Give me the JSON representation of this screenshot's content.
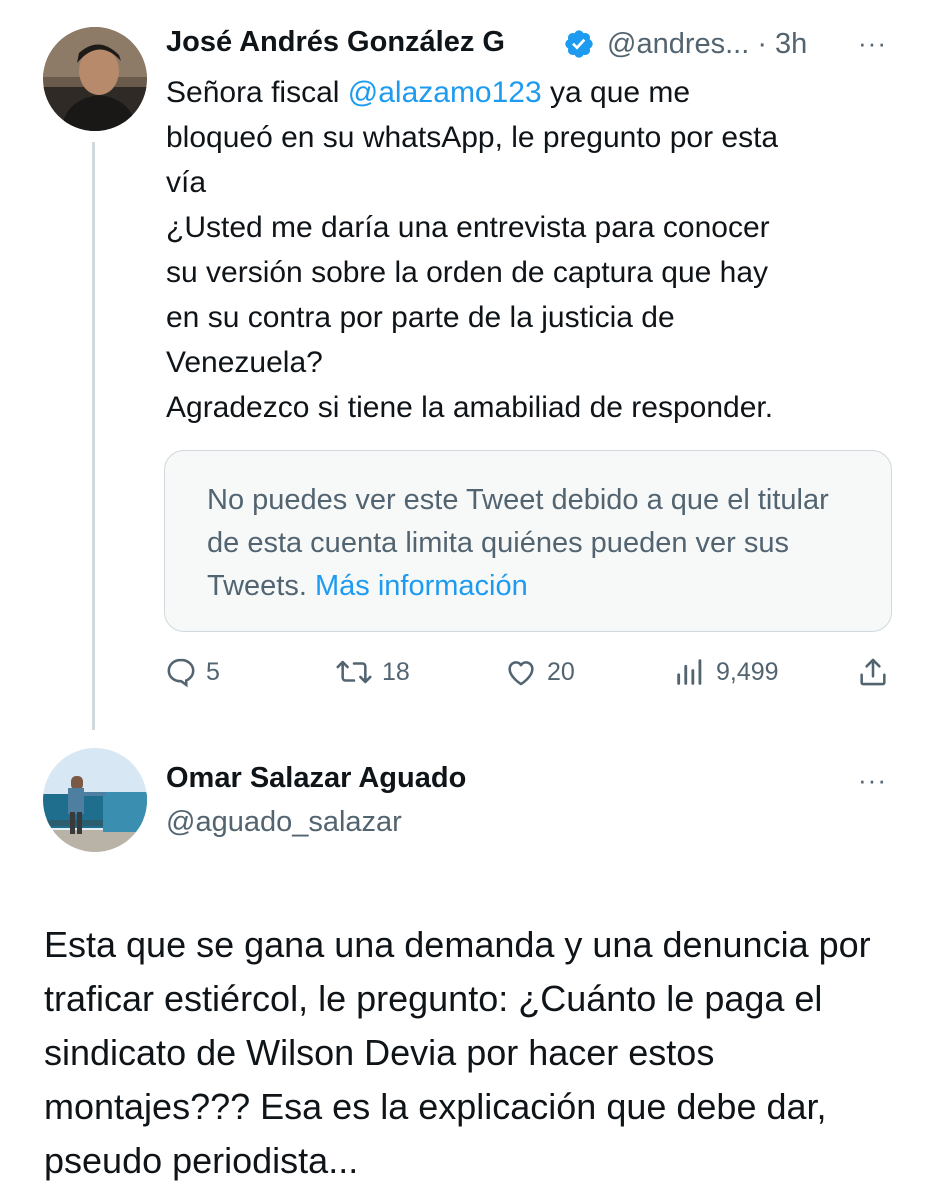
{
  "tweet": {
    "author_name": "José Andrés González G",
    "handle_time": "@andres... · 3h",
    "more_label": "···",
    "text": {
      "prefix": "Señora fiscal ",
      "mention": "@alazamo123",
      "line1_rest": " ya que me",
      "line2": "bloqueó en su whatsApp, le pregunto por esta",
      "line3": "vía",
      "line4": "¿Usted me daría una entrevista para conocer",
      "line5": "su versión sobre la orden de captura que hay",
      "line6": "en su contra por parte de la justicia de",
      "line7": "Venezuela?",
      "line8": "Agradezco si tiene la amabiliad de responder."
    },
    "limited_card": {
      "text": "No puedes ver este Tweet debido a que el titular de esta cuenta limita quiénes pueden ver sus Tweets.",
      "link": "Más información"
    },
    "actions": {
      "replies": "5",
      "retweets": "18",
      "likes": "20",
      "views": "9,499"
    },
    "colors": {
      "verified": "#1d9bf0",
      "link": "#1d9bf0",
      "muted": "#536471"
    }
  },
  "reply": {
    "author_name": "Omar Salazar Aguado",
    "handle": "@aguado_salazar",
    "more_label": "···",
    "text": "Esta que se gana una demanda y una denuncia por traficar estiércol, le pregunto: ¿Cuánto le paga el sindicato de  Wilson Devia por hacer estos montajes??? Esa es la explicación que debe dar, pseudo periodista..."
  }
}
